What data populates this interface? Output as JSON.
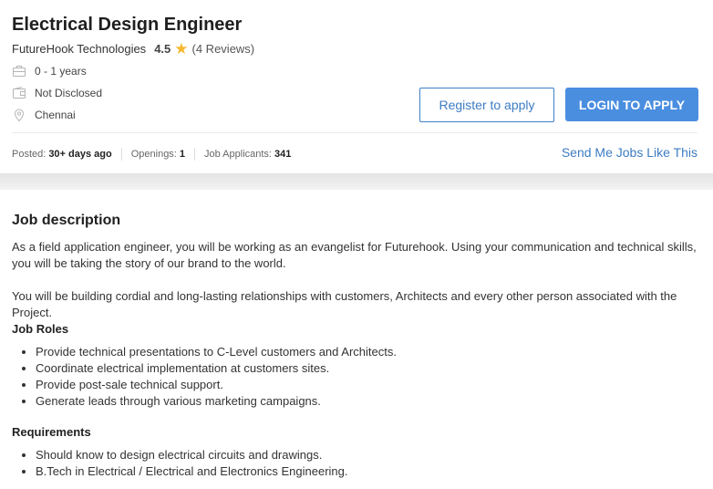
{
  "job": {
    "title": "Electrical Design Engineer",
    "company": "FutureHook Technologies",
    "rating": "4.5",
    "reviews": "(4 Reviews)",
    "experience": "0 - 1 years",
    "salary": "Not Disclosed",
    "location": "Chennai"
  },
  "actions": {
    "register_label": "Register to apply",
    "login_label": "LOGIN TO APPLY",
    "send_me_label": "Send Me Jobs Like This"
  },
  "stats": {
    "posted_label": "Posted:",
    "posted_value": "30+ days ago",
    "openings_label": "Openings:",
    "openings_value": "1",
    "applicants_label": "Job Applicants:",
    "applicants_value": "341"
  },
  "description": {
    "heading": "Job description",
    "para1": "As a field application engineer, you will be working as an evangelist for Futurehook. Using your communication and technical skills, you will be taking the story of our brand to the world.",
    "para2": "You will be building cordial and long-lasting relationships with customers, Architects and every other person associated with the Project.",
    "roles_heading": "Job Roles",
    "roles": [
      "Provide technical presentations to C-Level customers and Architects.",
      "Coordinate electrical implementation at customers sites.",
      "Provide post-sale technical support.",
      "Generate leads through various marketing campaigns."
    ],
    "req_heading": "Requirements",
    "requirements": [
      "Should know to design electrical circuits and drawings.",
      "B.Tech in Electrical / Electrical and Electronics Engineering."
    ]
  },
  "colors": {
    "accent": "#4a8ee0",
    "link": "#3d7cc3",
    "star": "#f5b82e"
  },
  "icons": [
    "briefcase-icon",
    "wallet-icon",
    "location-pin-icon",
    "star-icon"
  ]
}
